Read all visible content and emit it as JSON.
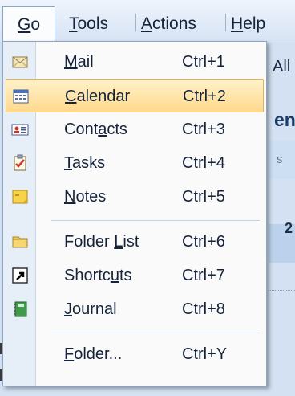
{
  "menubar": {
    "go": {
      "pre": "",
      "u": "G",
      "post": "o"
    },
    "tools": {
      "pre": "",
      "u": "T",
      "post": "ools"
    },
    "actions": {
      "pre": "",
      "u": "A",
      "post": "ctions"
    },
    "help": {
      "pre": "",
      "u": "H",
      "post": "elp"
    }
  },
  "background": {
    "frag_all": "All",
    "frag_en": "en",
    "frag_s": "s",
    "frag_z": "2"
  },
  "go_menu": {
    "items": [
      {
        "pre": "",
        "u": "M",
        "post": "ail",
        "shortcut": "Ctrl+1",
        "icon": "mail-icon",
        "selected": false
      },
      {
        "pre": "",
        "u": "C",
        "post": "alendar",
        "shortcut": "Ctrl+2",
        "icon": "calendar-icon",
        "selected": true
      },
      {
        "pre": "Cont",
        "u": "a",
        "post": "cts",
        "shortcut": "Ctrl+3",
        "icon": "contacts-icon",
        "selected": false
      },
      {
        "pre": "",
        "u": "T",
        "post": "asks",
        "shortcut": "Ctrl+4",
        "icon": "tasks-icon",
        "selected": false
      },
      {
        "pre": "",
        "u": "N",
        "post": "otes",
        "shortcut": "Ctrl+5",
        "icon": "notes-icon",
        "selected": false
      },
      {
        "pre": "Folder ",
        "u": "L",
        "post": "ist",
        "shortcut": "Ctrl+6",
        "icon": "folder-icon",
        "selected": false
      },
      {
        "pre": "Shortc",
        "u": "u",
        "post": "ts",
        "shortcut": "Ctrl+7",
        "icon": "shortcut-icon",
        "selected": false
      },
      {
        "pre": "",
        "u": "J",
        "post": "ournal",
        "shortcut": "Ctrl+8",
        "icon": "journal-icon",
        "selected": false
      },
      {
        "pre": "",
        "u": "F",
        "post": "older...",
        "shortcut": "Ctrl+Y",
        "icon": "",
        "selected": false
      }
    ]
  },
  "colors": {
    "highlight": "#ffd98e",
    "menubar": "#d6e3f4",
    "gutter": "#e6eef8"
  }
}
